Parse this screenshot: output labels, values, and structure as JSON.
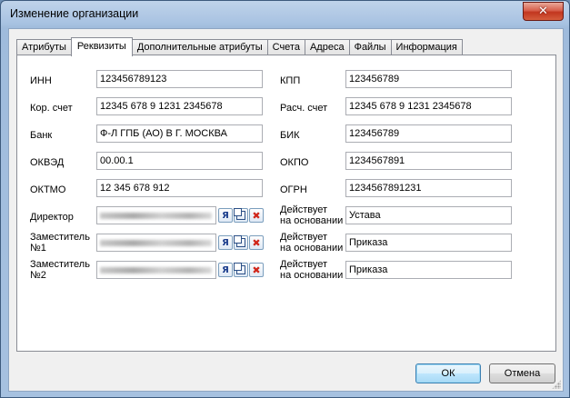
{
  "window": {
    "title": "Изменение организации",
    "close_label": "✕"
  },
  "tabs": [
    {
      "label": "Атрибуты",
      "active": false
    },
    {
      "label": "Реквизиты",
      "active": true
    },
    {
      "label": "Дополнительные атрибуты",
      "active": false
    },
    {
      "label": "Счета",
      "active": false
    },
    {
      "label": "Адреса",
      "active": false
    },
    {
      "label": "Файлы",
      "active": false
    },
    {
      "label": "Информация",
      "active": false
    }
  ],
  "form": {
    "inn": {
      "label": "ИНН",
      "value": "123456789123"
    },
    "kpp": {
      "label": "КПП",
      "value": "123456789"
    },
    "kor_schet": {
      "label": "Кор. счет",
      "value": "12345 678 9 1231 2345678"
    },
    "ras_schet": {
      "label": "Расч. счет",
      "value": "12345 678 9 1231 2345678"
    },
    "bank": {
      "label": "Банк",
      "value": "Ф-Л ГПБ (АО) В Г. МОСКВА"
    },
    "bik": {
      "label": "БИК",
      "value": "123456789"
    },
    "okved": {
      "label": "ОКВЭД",
      "value": "00.00.1"
    },
    "okpo": {
      "label": "ОКПО",
      "value": "1234567891"
    },
    "oktmo": {
      "label": "ОКТМО",
      "value": "12 345 678 912"
    },
    "ogrn": {
      "label": "ОГРН",
      "value": "1234567891231"
    },
    "director": {
      "label": "Директор",
      "basis_label_1": "Действует",
      "basis_label_2": "на основании",
      "basis": "Устава"
    },
    "deputy1": {
      "label_1": "Заместитель",
      "label_2": "№1",
      "basis_label_1": "Действует",
      "basis_label_2": "на основании",
      "basis": "Приказа"
    },
    "deputy2": {
      "label_1": "Заместитель",
      "label_2": "№2",
      "basis_label_1": "Действует",
      "basis_label_2": "на основании",
      "basis": "Приказа"
    },
    "select_icon_glyph": "Я",
    "clear_icon_glyph": "✖"
  },
  "buttons": {
    "ok": "ОК",
    "cancel": "Отмена"
  }
}
